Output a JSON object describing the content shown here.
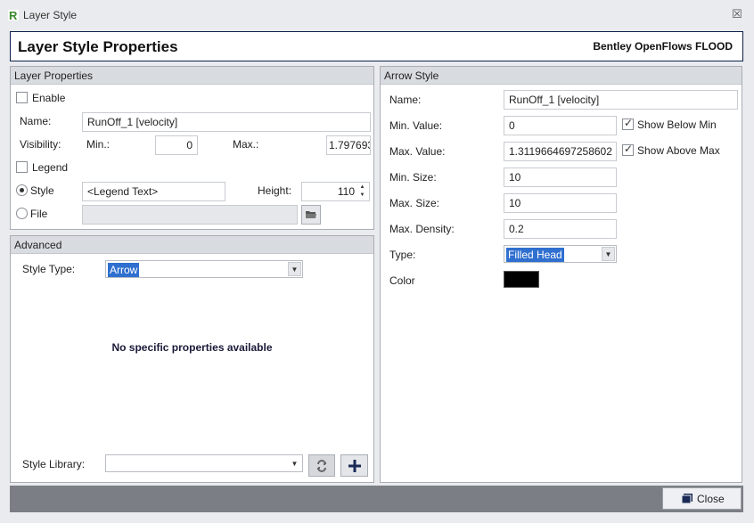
{
  "window": {
    "title": "Layer Style",
    "close_glyph": "☒"
  },
  "header": {
    "title": "Layer Style Properties",
    "brand": "Bentley OpenFlows FLOOD"
  },
  "layer_properties": {
    "heading": "Layer Properties",
    "enable_label": "Enable",
    "enable_checked": false,
    "name_label": "Name:",
    "name_value": "RunOff_1 [velocity]",
    "visibility_label": "Visibility:",
    "min_label": "Min.:",
    "min_value": "0",
    "max_label": "Max.:",
    "max_value": "1.797693",
    "legend_label": "Legend",
    "legend_checked": false,
    "style_label": "Style",
    "style_selected": true,
    "style_value": "<Legend Text>",
    "height_label": "Height:",
    "height_value": "110",
    "file_label": "File",
    "file_selected": false,
    "file_value": ""
  },
  "advanced": {
    "heading": "Advanced",
    "style_type_label": "Style Type:",
    "style_type_value": "Arrow",
    "no_props_text": "No specific properties available",
    "style_library_label": "Style Library:",
    "style_library_value": ""
  },
  "arrow_style": {
    "heading": "Arrow Style",
    "name_label": "Name:",
    "name_value": "RunOff_1 [velocity]",
    "min_value_label": "Min. Value:",
    "min_value": "0",
    "show_below_min_label": "Show Below Min",
    "show_below_min_checked": true,
    "max_value_label": "Max. Value:",
    "max_value": "1.3119664697258602",
    "show_above_max_label": "Show Above Max",
    "show_above_max_checked": true,
    "min_size_label": "Min. Size:",
    "min_size": "10",
    "max_size_label": "Max. Size:",
    "max_size": "10",
    "max_density_label": "Max. Density:",
    "max_density": "0.2",
    "type_label": "Type:",
    "type_value": "Filled Head",
    "color_label": "Color",
    "color_value": "#000000"
  },
  "footer": {
    "close_label": "Close"
  },
  "icons": {
    "app": "bentley-r-icon",
    "folder": "folder-icon",
    "refresh": "refresh-icon",
    "add": "plus-icon",
    "close": "window-icon"
  },
  "colors": {
    "accent": "#2f6fcf",
    "header_border": "#0c1f4a",
    "footer_bg": "#7b7f85"
  }
}
